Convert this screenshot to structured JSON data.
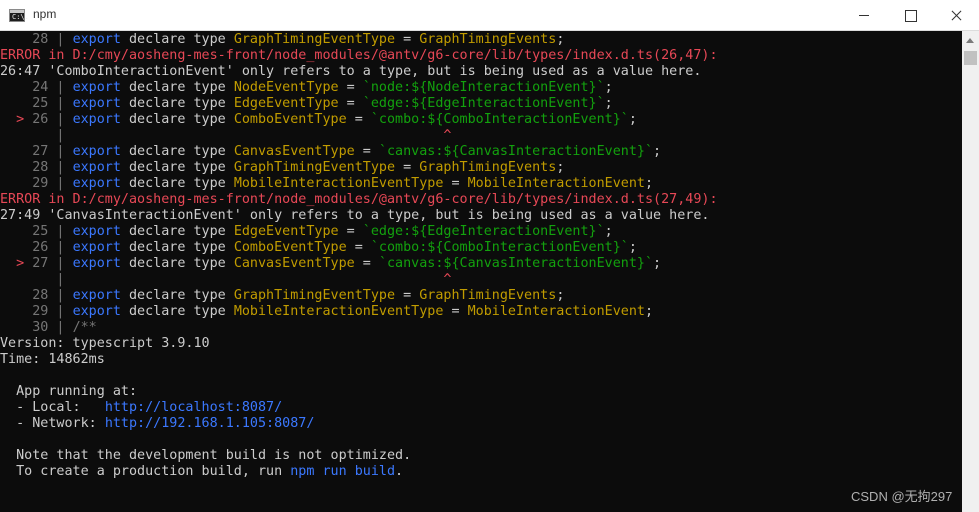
{
  "window": {
    "title": "npm",
    "app_icon": "cmd-icon",
    "app_icon_text": "C:\\.",
    "controls": [
      "minimize-icon",
      "maximize-icon",
      "close-icon"
    ]
  },
  "colors": {
    "background": "#0c0c0c",
    "text": "#cccccc",
    "gutter": "#767676",
    "keyword": "#3b78ff",
    "identifier": "#c19c00",
    "template": "#13a10e",
    "error": "#e74856"
  },
  "terminal_lines": [
    [
      {
        "t": "    28 | ",
        "c": "gray"
      },
      {
        "t": "export",
        "c": "blue"
      },
      {
        "t": " declare type ",
        "c": "wht"
      },
      {
        "t": "GraphTimingEventType",
        "c": "yel"
      },
      {
        "t": " = ",
        "c": "wht"
      },
      {
        "t": "GraphTimingEvents",
        "c": "yel"
      },
      {
        "t": ";",
        "c": "wht"
      }
    ],
    [
      {
        "t": "ERROR in D:/cmy/aosheng-mes-front/node_modules/@antv/g6-core/lib/types/index.d.ts(26,47):",
        "c": "red"
      }
    ],
    [
      {
        "t": "26:47 'ComboInteractionEvent' only refers to a type, but is being used as a value here.",
        "c": "wht"
      }
    ],
    [
      {
        "t": "    24 | ",
        "c": "gray"
      },
      {
        "t": "export",
        "c": "blue"
      },
      {
        "t": " declare type ",
        "c": "wht"
      },
      {
        "t": "NodeEventType",
        "c": "yel"
      },
      {
        "t": " = ",
        "c": "wht"
      },
      {
        "t": "`node:${NodeInteractionEvent}`",
        "c": "grn"
      },
      {
        "t": ";",
        "c": "wht"
      }
    ],
    [
      {
        "t": "    25 | ",
        "c": "gray"
      },
      {
        "t": "export",
        "c": "blue"
      },
      {
        "t": " declare type ",
        "c": "wht"
      },
      {
        "t": "EdgeEventType",
        "c": "yel"
      },
      {
        "t": " = ",
        "c": "wht"
      },
      {
        "t": "`edge:${EdgeInteractionEvent}`",
        "c": "grn"
      },
      {
        "t": ";",
        "c": "wht"
      }
    ],
    [
      {
        "t": "  > ",
        "c": "red"
      },
      {
        "t": "26 | ",
        "c": "gray"
      },
      {
        "t": "export",
        "c": "blue"
      },
      {
        "t": " declare type ",
        "c": "wht"
      },
      {
        "t": "ComboEventType",
        "c": "yel"
      },
      {
        "t": " = ",
        "c": "wht"
      },
      {
        "t": "`combo:${ComboInteractionEvent}`",
        "c": "grn"
      },
      {
        "t": ";",
        "c": "wht"
      }
    ],
    [
      {
        "t": "       | ",
        "c": "gray"
      },
      {
        "t": "                                              ^",
        "c": "red"
      }
    ],
    [
      {
        "t": "    27 | ",
        "c": "gray"
      },
      {
        "t": "export",
        "c": "blue"
      },
      {
        "t": " declare type ",
        "c": "wht"
      },
      {
        "t": "CanvasEventType",
        "c": "yel"
      },
      {
        "t": " = ",
        "c": "wht"
      },
      {
        "t": "`canvas:${CanvasInteractionEvent}`",
        "c": "grn"
      },
      {
        "t": ";",
        "c": "wht"
      }
    ],
    [
      {
        "t": "    28 | ",
        "c": "gray"
      },
      {
        "t": "export",
        "c": "blue"
      },
      {
        "t": " declare type ",
        "c": "wht"
      },
      {
        "t": "GraphTimingEventType",
        "c": "yel"
      },
      {
        "t": " = ",
        "c": "wht"
      },
      {
        "t": "GraphTimingEvents",
        "c": "yel"
      },
      {
        "t": ";",
        "c": "wht"
      }
    ],
    [
      {
        "t": "    29 | ",
        "c": "gray"
      },
      {
        "t": "export",
        "c": "blue"
      },
      {
        "t": " declare type ",
        "c": "wht"
      },
      {
        "t": "MobileInteractionEventType",
        "c": "yel"
      },
      {
        "t": " = ",
        "c": "wht"
      },
      {
        "t": "MobileInteractionEvent",
        "c": "yel"
      },
      {
        "t": ";",
        "c": "wht"
      }
    ],
    [
      {
        "t": "ERROR in D:/cmy/aosheng-mes-front/node_modules/@antv/g6-core/lib/types/index.d.ts(27,49):",
        "c": "red"
      }
    ],
    [
      {
        "t": "27:49 'CanvasInteractionEvent' only refers to a type, but is being used as a value here.",
        "c": "wht"
      }
    ],
    [
      {
        "t": "    25 | ",
        "c": "gray"
      },
      {
        "t": "export",
        "c": "blue"
      },
      {
        "t": " declare type ",
        "c": "wht"
      },
      {
        "t": "EdgeEventType",
        "c": "yel"
      },
      {
        "t": " = ",
        "c": "wht"
      },
      {
        "t": "`edge:${EdgeInteractionEvent}`",
        "c": "grn"
      },
      {
        "t": ";",
        "c": "wht"
      }
    ],
    [
      {
        "t": "    26 | ",
        "c": "gray"
      },
      {
        "t": "export",
        "c": "blue"
      },
      {
        "t": " declare type ",
        "c": "wht"
      },
      {
        "t": "ComboEventType",
        "c": "yel"
      },
      {
        "t": " = ",
        "c": "wht"
      },
      {
        "t": "`combo:${ComboInteractionEvent}`",
        "c": "grn"
      },
      {
        "t": ";",
        "c": "wht"
      }
    ],
    [
      {
        "t": "  > ",
        "c": "red"
      },
      {
        "t": "27 | ",
        "c": "gray"
      },
      {
        "t": "export",
        "c": "blue"
      },
      {
        "t": " declare type ",
        "c": "wht"
      },
      {
        "t": "CanvasEventType",
        "c": "yel"
      },
      {
        "t": " = ",
        "c": "wht"
      },
      {
        "t": "`canvas:${CanvasInteractionEvent}`",
        "c": "grn"
      },
      {
        "t": ";",
        "c": "wht"
      }
    ],
    [
      {
        "t": "       | ",
        "c": "gray"
      },
      {
        "t": "                                              ^",
        "c": "red"
      }
    ],
    [
      {
        "t": "    28 | ",
        "c": "gray"
      },
      {
        "t": "export",
        "c": "blue"
      },
      {
        "t": " declare type ",
        "c": "wht"
      },
      {
        "t": "GraphTimingEventType",
        "c": "yel"
      },
      {
        "t": " = ",
        "c": "wht"
      },
      {
        "t": "GraphTimingEvents",
        "c": "yel"
      },
      {
        "t": ";",
        "c": "wht"
      }
    ],
    [
      {
        "t": "    29 | ",
        "c": "gray"
      },
      {
        "t": "export",
        "c": "blue"
      },
      {
        "t": " declare type ",
        "c": "wht"
      },
      {
        "t": "MobileInteractionEventType",
        "c": "yel"
      },
      {
        "t": " = ",
        "c": "wht"
      },
      {
        "t": "MobileInteractionEvent",
        "c": "yel"
      },
      {
        "t": ";",
        "c": "wht"
      }
    ],
    [
      {
        "t": "    30 | ",
        "c": "gray"
      },
      {
        "t": "/**",
        "c": "gray"
      }
    ],
    [
      {
        "t": "Version: typescript 3.9.10",
        "c": "wht"
      }
    ],
    [
      {
        "t": "Time: 14862ms",
        "c": "wht"
      }
    ],
    [
      {
        "t": "",
        "c": "wht"
      }
    ],
    [
      {
        "t": "  App running at:",
        "c": "wht"
      }
    ],
    [
      {
        "t": "  - Local:   ",
        "c": "wht"
      },
      {
        "t": "http://localhost:8087/",
        "c": "blue"
      }
    ],
    [
      {
        "t": "  - Network: ",
        "c": "wht"
      },
      {
        "t": "http://192.168.1.105:8087/",
        "c": "blue"
      }
    ],
    [
      {
        "t": "",
        "c": "wht"
      }
    ],
    [
      {
        "t": "  Note that the development build is not optimized.",
        "c": "wht"
      }
    ],
    [
      {
        "t": "  To create a production build, run ",
        "c": "wht"
      },
      {
        "t": "npm run build",
        "c": "blue"
      },
      {
        "t": ".",
        "c": "wht"
      }
    ]
  ],
  "scrollbar": {
    "icon": "scroll-up-arrow-icon"
  },
  "watermark": "CSDN @无拘297"
}
